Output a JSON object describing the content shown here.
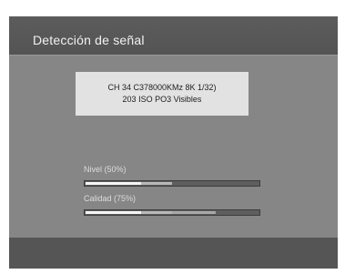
{
  "dialog": {
    "title": "Detección de señal"
  },
  "signal_info": {
    "line1": "CH 34 C378000KMz 8K 1/32)",
    "line2": "203 ISO PO3 Visibles"
  },
  "meters": {
    "level": {
      "label": "Nivel (50%)",
      "percent": 50
    },
    "quality": {
      "label": "Calidad (75%)",
      "percent": 75
    }
  },
  "colors": {
    "panel": "#868686",
    "header": "#5a5a5a",
    "footer": "#555555",
    "info_box": "#e2e2e2"
  }
}
